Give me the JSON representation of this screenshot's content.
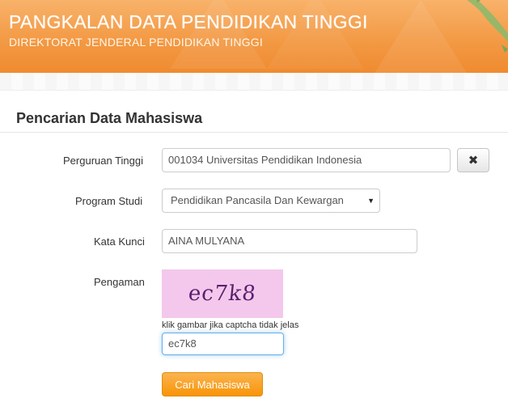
{
  "header": {
    "title": "PANGKALAN DATA PENDIDIKAN TINGGI",
    "subtitle": "DIREKTORAT JENDERAL PENDIDIKAN TINGGI"
  },
  "page": {
    "heading": "Pencarian Data Mahasiswa"
  },
  "form": {
    "university": {
      "label": "Perguruan Tinggi",
      "value": "001034   Universitas Pendidikan Indonesia",
      "clear_icon": "✖"
    },
    "program": {
      "label": "Program Studi",
      "selected": "Pendidikan Pancasila Dan Kewargan",
      "arrow": "▼"
    },
    "keyword": {
      "label": "Kata Kunci",
      "value": "AINA MULYANA"
    },
    "security": {
      "label": "Pengaman",
      "captcha_image_text": "ec7k8",
      "hint": "klik gambar jika captcha tidak jelas",
      "value": "ec7k8"
    },
    "submit_label": "Cari Mahasiswa"
  },
  "colors": {
    "banner": "#f39a45",
    "button": "#f89406",
    "captcha_bg": "#f3c8ec"
  }
}
